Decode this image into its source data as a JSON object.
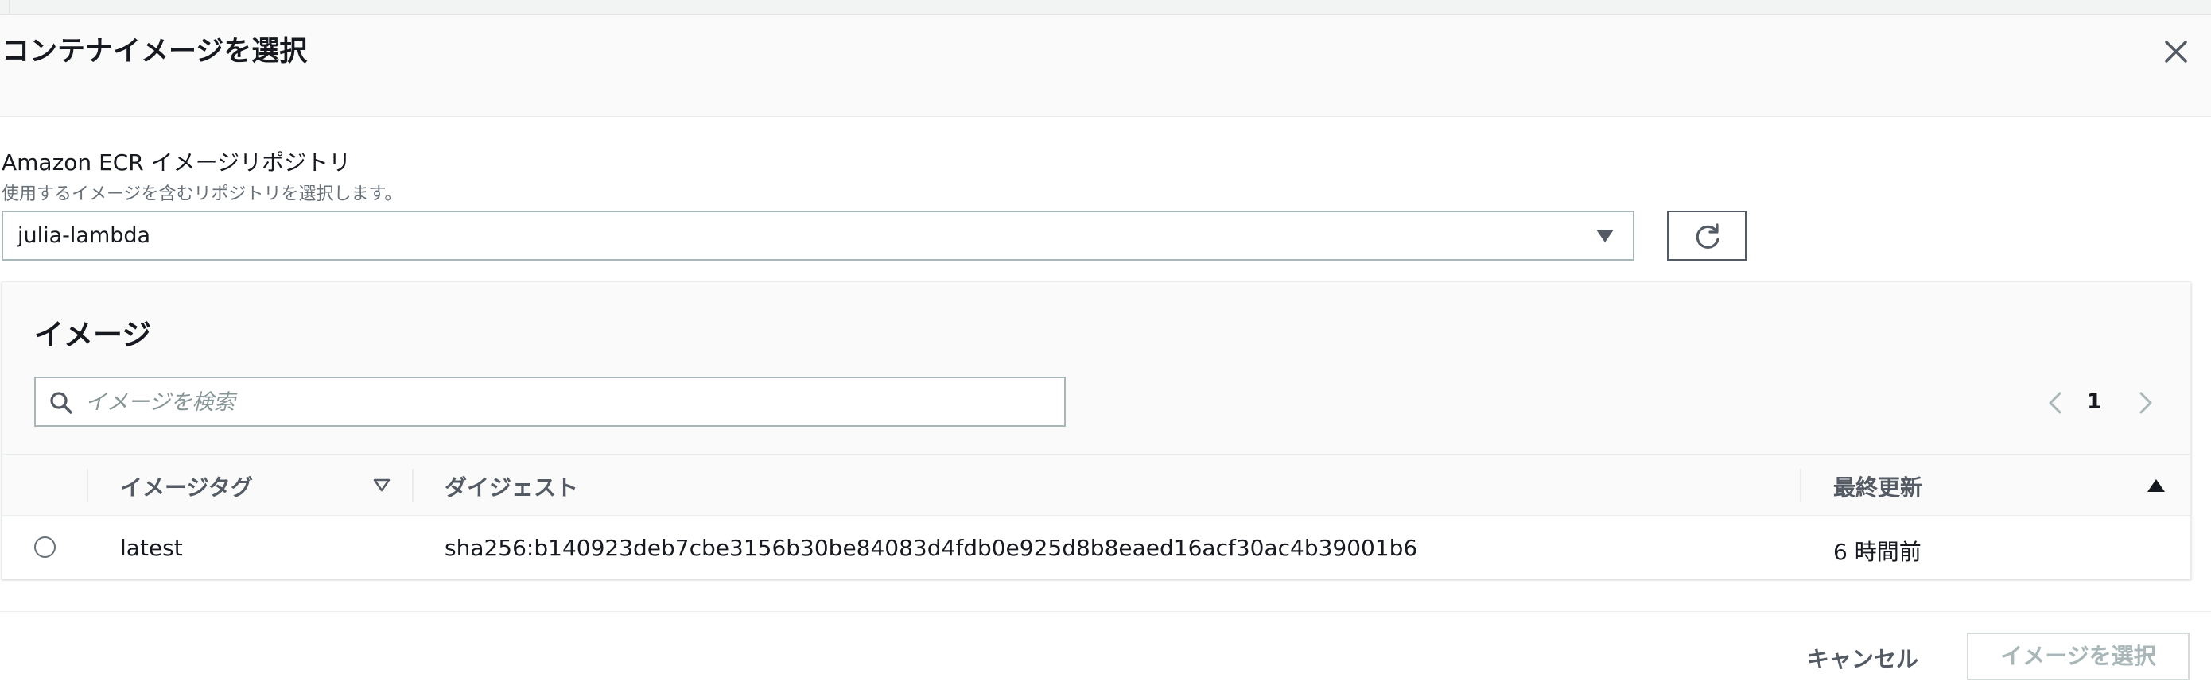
{
  "modal": {
    "title": "コンテナイメージを選択"
  },
  "repository": {
    "label": "Amazon ECR イメージリポジトリ",
    "description": "使用するイメージを含むリポジトリを選択します。",
    "selected": "julia-lambda"
  },
  "images": {
    "title": "イメージ",
    "search_placeholder": "イメージを検索",
    "pagination": {
      "current_page": "1"
    },
    "columns": {
      "tag": "イメージタグ",
      "digest": "ダイジェスト",
      "updated": "最終更新"
    },
    "rows": [
      {
        "tag": "latest",
        "digest": "sha256:b140923deb7cbe3156b30be84083d4fdb0e925d8b8eaed16acf30ac4b39001b6",
        "updated": "6 時間前"
      }
    ]
  },
  "footer": {
    "cancel_label": "キャンセル",
    "select_label": "イメージを選択"
  },
  "icons": {
    "close": "close-icon",
    "caret": "caret-down-icon",
    "refresh": "refresh-icon",
    "search": "search-icon",
    "prev": "chevron-left-icon",
    "next": "chevron-right-icon",
    "sort_tag": "sort-caret-down-icon",
    "sort_updated": "sort-caret-up-icon"
  },
  "colors": {
    "text": "#16191f",
    "muted": "#687078",
    "border": "#aab7b8",
    "disabled": "#aab7b8"
  }
}
